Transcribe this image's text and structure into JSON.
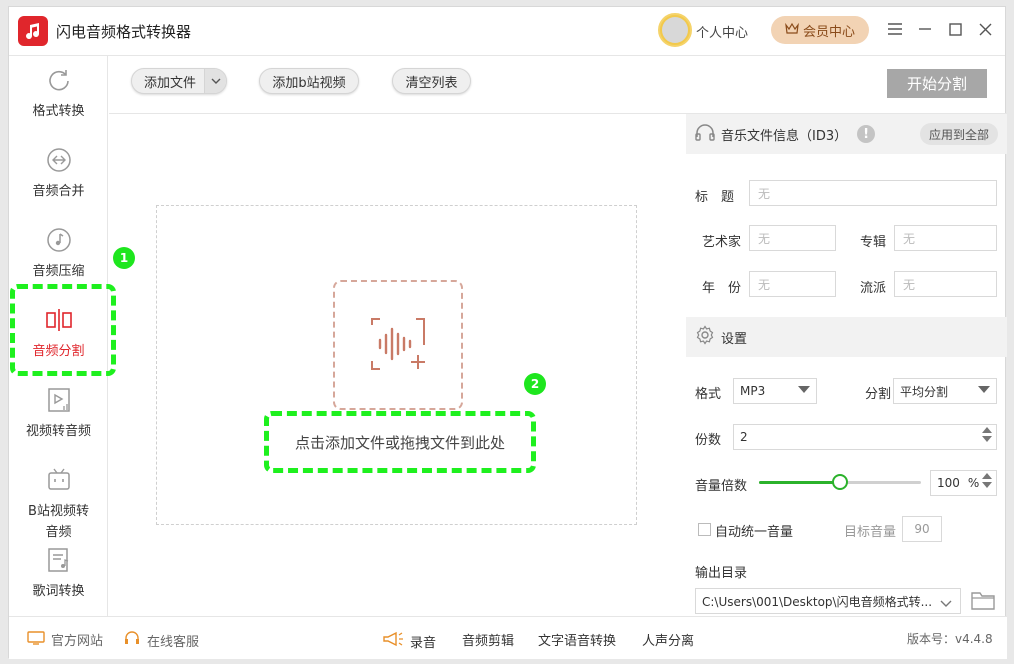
{
  "app": {
    "title": "闪电音频格式转换器"
  },
  "header": {
    "personal_center": "个人中心",
    "vip_center": "会员中心"
  },
  "sidebar": {
    "items": [
      {
        "label": "格式转换",
        "icon": "refresh-icon"
      },
      {
        "label": "音频合并",
        "icon": "merge-icon"
      },
      {
        "label": "音频压缩",
        "icon": "music-note-icon"
      },
      {
        "label": "音频分割",
        "icon": "split-icon",
        "active": true
      },
      {
        "label": "视频转音频",
        "icon": "video-audio-icon"
      },
      {
        "label": "B站视频转音频",
        "label_line1": "B站视频转",
        "label_line2": "音频",
        "icon": "bilibili-icon"
      },
      {
        "label": "歌词转换",
        "icon": "lyrics-icon"
      }
    ]
  },
  "annotations": {
    "badge1": "1",
    "badge2": "2"
  },
  "toolbar": {
    "add_file": "添加文件",
    "add_bilibili": "添加b站视频",
    "clear_list": "清空列表",
    "start_split": "开始分割"
  },
  "drop": {
    "hint": "点击添加文件或拖拽文件到此处"
  },
  "id3": {
    "header": "音乐文件信息（ID3）",
    "apply_all": "应用到全部",
    "title_label": "标　题",
    "artist_label": "艺术家",
    "album_label": "专辑",
    "year_label": "年　份",
    "genre_label": "流派",
    "placeholder": "无"
  },
  "settings": {
    "header": "设置",
    "format_label": "格式",
    "format_value": "MP3",
    "split_label": "分割",
    "split_value": "平均分割",
    "parts_label": "份数",
    "parts_value": "2",
    "volume_label": "音量倍数",
    "volume_value": "100",
    "volume_unit": "%",
    "volume_fraction": 0.5,
    "auto_volume_label": "自动统一音量",
    "target_volume_label": "目标音量",
    "target_volume_value": "90",
    "output_label": "输出目录",
    "output_path": "C:\\Users\\001\\Desktop\\闪电音频格式转..."
  },
  "footer": {
    "website": "官方网站",
    "support": "在线客服",
    "record": "录音",
    "edit": "音频剪辑",
    "tts": "文字语音转换",
    "vocal": "人声分离",
    "version": "版本号：v4.4.8"
  },
  "colors": {
    "accent": "#e0262c",
    "highlight": "#1ef01e",
    "slider": "#2bb22b"
  }
}
